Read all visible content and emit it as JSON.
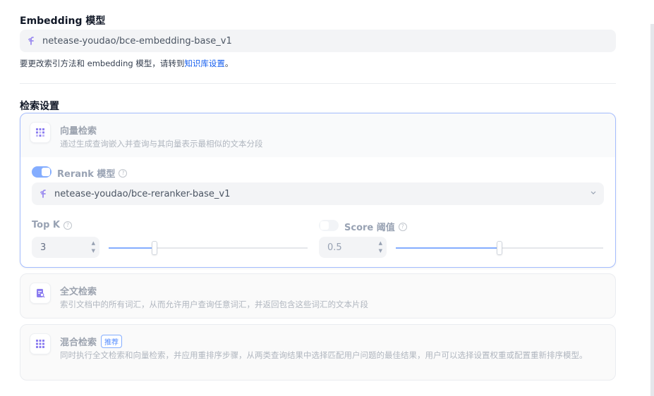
{
  "embedding": {
    "title": "Embedding 模型",
    "model_name": "netease-youdao/bce-embedding-base_v1",
    "hint_prefix": "要更改索引方法和 embedding 模型，请转到",
    "hint_link": "知识库设置",
    "hint_suffix": "。"
  },
  "retrieval": {
    "title": "检索设置",
    "vector": {
      "title": "向量检索",
      "description": "通过生成查询嵌入并查询与其向量表示最相似的文本分段",
      "rerank_label": "Rerank 模型",
      "rerank_enabled": true,
      "rerank_model": "netease-youdao/bce-reranker-base_v1",
      "top_k_label": "Top K",
      "top_k_value": "3",
      "top_k_fraction": 0.23,
      "score_label": "Score 阈值",
      "score_enabled": false,
      "score_value": "0.5",
      "score_fraction": 0.5
    },
    "fulltext": {
      "title": "全文检索",
      "description": "索引文档中的所有词汇，从而允许用户查询任意词汇，并返回包含这些词汇的文本片段"
    },
    "hybrid": {
      "title": "混合检索",
      "badge": "推荐",
      "description": "同时执行全文检索和向量检索，并应用重排序步骤，从两类查询结果中选择匹配用户问题的最佳结果，用户可以选择设置权重或配置重新排序模型。"
    }
  },
  "colors": {
    "accent": "#84adff",
    "link": "#155eef",
    "active_border": "#a4bcfd"
  }
}
